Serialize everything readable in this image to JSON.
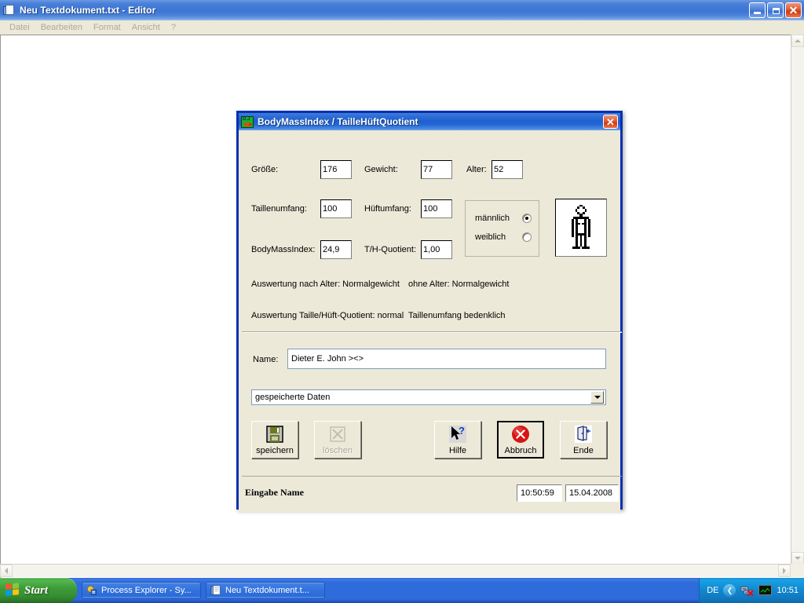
{
  "notepad": {
    "title": "Neu Textdokument.txt - Editor",
    "icon": "notepad-icon",
    "menu": [
      "Datei",
      "Bearbeiten",
      "Format",
      "Ansicht",
      "?"
    ],
    "window_buttons": {
      "minimize": "minimize-icon",
      "restore": "restore-icon",
      "close": "✕"
    }
  },
  "dialog": {
    "title": "BodyMassIndex / TailleHüftQuotient",
    "close_label": "✕",
    "fields": {
      "groesse": {
        "label": "Größe:",
        "value": "176"
      },
      "gewicht": {
        "label": "Gewicht:",
        "value": "77"
      },
      "alter": {
        "label": "Alter:",
        "value": "52"
      },
      "taillenumfang": {
        "label": "Taillenumfang:",
        "value": "100"
      },
      "hueftumfang": {
        "label": "Hüftumfang:",
        "value": "100"
      },
      "bodymassindex": {
        "label": "BodyMassIndex:",
        "value": "24,9"
      },
      "thquotient": {
        "label": "T/H-Quotient:",
        "value": "1,00"
      }
    },
    "gender": {
      "options": [
        {
          "label": "männlich",
          "selected": true
        },
        {
          "label": "weiblich",
          "selected": false
        }
      ]
    },
    "figure_icon": "person-figure-icon",
    "results": {
      "line1_left": "Auswertung nach Alter: Normalgewicht",
      "line1_right": "ohne Alter: Normalgewicht",
      "line2_left": "Auswertung Taille/Hüft-Quotient: normal",
      "line2_right": "Taillenumfang bedenklich"
    },
    "name_field": {
      "label": "Name:",
      "value": "Dieter E. John  ><>"
    },
    "combo": {
      "value": "gespeicherte Daten",
      "options": [
        "gespeicherte Daten"
      ]
    },
    "buttons": [
      {
        "id": "speichern",
        "label": "speichern",
        "icon": "floppy-disk-icon",
        "disabled": false,
        "focused": false
      },
      {
        "id": "loeschen",
        "label": "löschen",
        "icon": "delete-x-icon",
        "disabled": true,
        "focused": false
      },
      {
        "id": "hilfe",
        "label": "Hilfe",
        "icon": "help-cursor-icon",
        "disabled": false,
        "focused": false
      },
      {
        "id": "abbruch",
        "label": "Abbruch",
        "icon": "cancel-circle-icon",
        "disabled": false,
        "focused": true
      },
      {
        "id": "ende",
        "label": "Ende",
        "icon": "exit-door-icon",
        "disabled": false,
        "focused": false
      }
    ],
    "statusbar": {
      "text": "Eingabe Name",
      "time": "10:50:59",
      "date": "15.04.2008"
    }
  },
  "taskbar": {
    "start_label": "Start",
    "items": [
      {
        "label": "Process Explorer - Sy...",
        "icon": "process-explorer-icon"
      },
      {
        "label": "Neu Textdokument.t...",
        "icon": "notepad-icon"
      }
    ],
    "tray": {
      "language": "DE",
      "chevron": "❮",
      "network_icon": "network-disconnected-icon",
      "monitor_icon": "monitor-icon",
      "clock": "10:51"
    }
  },
  "colors": {
    "title_blue": "#0831b0",
    "dialog_face": "#ece9d8",
    "accent_red": "#cf3a13",
    "start_green": "#3e9c38",
    "taskbar_blue": "#2e6bdb"
  }
}
